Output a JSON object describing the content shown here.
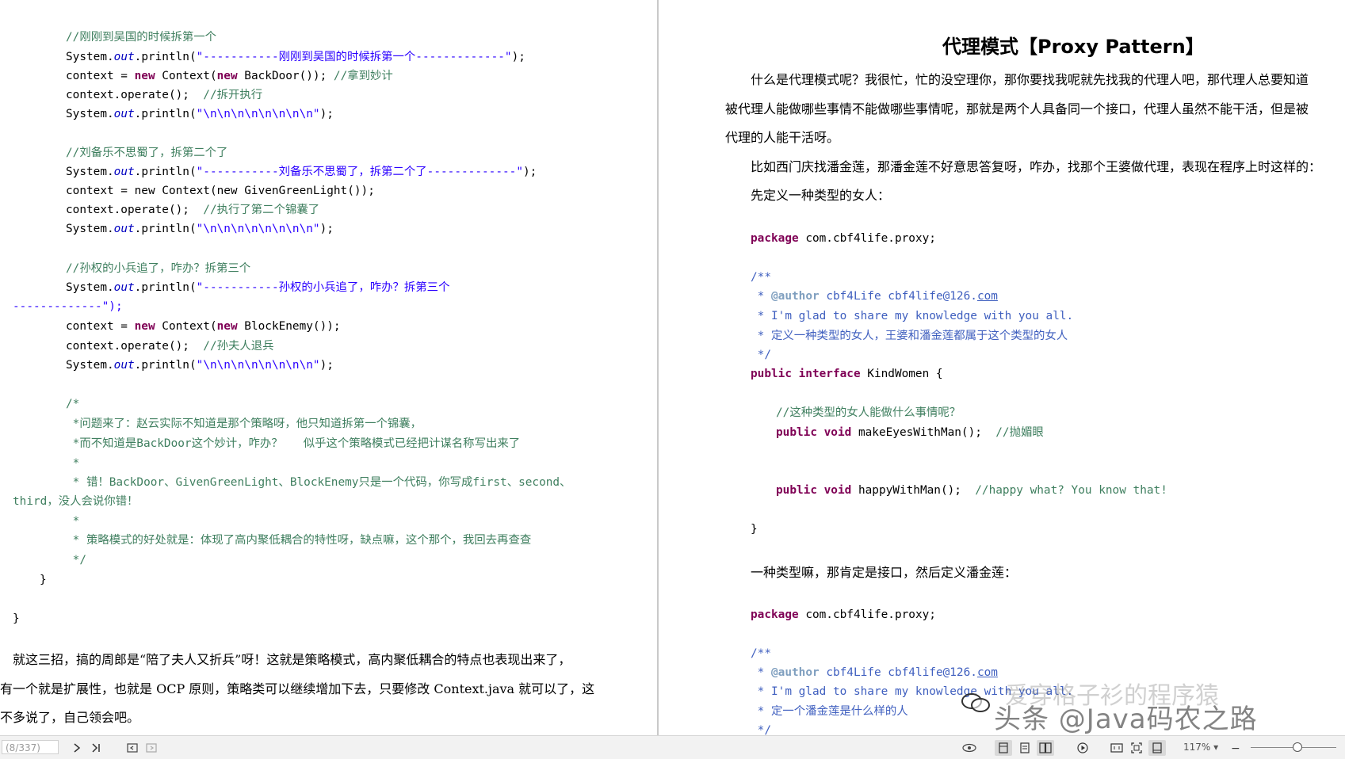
{
  "left": {
    "code_block": [
      "//刚刚到吴国的时候拆第一个",
      "System.out.println(\"-----------刚刚到吴国的时候拆第一个-------------\");",
      "context = new Context(new BackDoor()); //拿到妙计",
      "context.operate();  //拆开执行",
      "System.out.println(\"\\n\\n\\n\\n\\n\\n\\n\\n\");",
      "//刘备乐不思蜀了，拆第二个了",
      "System.out.println(\"-----------刘备乐不思蜀了，拆第二个了-------------\");",
      "context = new Context(new GivenGreenLight());",
      "context.operate();  //执行了第二个锦囊了",
      "System.out.println(\"\\n\\n\\n\\n\\n\\n\\n\\n\");",
      "//孙权的小兵追了，咋办？拆第三个",
      "System.out.println(\"-----------孙权的小兵追了，咋办？拆第三个",
      "-------------\");",
      "context = new Context(new BlockEnemy());",
      "context.operate();  //孙夫人退兵",
      "System.out.println(\"\\n\\n\\n\\n\\n\\n\\n\\n\");",
      "/*",
      " *问题来了：赵云实际不知道是那个策略呀，他只知道拆第一个锦囊，",
      " *而不知道是BackDoor这个妙计，咋办？   似乎这个策略模式已经把计谋名称写出来了",
      " *",
      " * 错！BackDoor、GivenGreenLight、BlockEnemy只是一个代码，你写成first、second、",
      "third，没人会说你错！",
      " *",
      " * 策略模式的好处就是：体现了高内聚低耦合的特性呀，缺点嘛，这个那个，我回去再查查",
      " */",
      "}",
      "}"
    ],
    "paragraph_lines": [
      "就这三招，搞的周郎是“陪了夫人又折兵”呀！这就是策略模式，高内聚低耦合的特点也表现出来了，",
      "有一个就是扩展性，也就是 OCP 原则，策略类可以继续增加下去，只要修改 Context.java 就可以了，这",
      "不多说了，自己领会吧。"
    ]
  },
  "right": {
    "title": "代理模式【Proxy Pattern】",
    "intro_lines": [
      "什么是代理模式呢？我很忙，忙的没空理你，那你要找我呢就先找我的代理人吧，那代理人总要知道",
      "被代理人能做哪些事情不能做哪些事情呢，那就是两个人具备同一个接口，代理人虽然不能干活，但是被",
      "代理的人能干活呀。",
      "比如西门庆找潘金莲，那潘金莲不好意思答复呀，咋办，找那个王婆做代理，表现在程序上时这样的：",
      "先定义一种类型的女人："
    ],
    "code1": [
      "package com.cbf4life.proxy;",
      "/**",
      " * @author cbf4Life cbf4life@126.com",
      " * I'm glad to share my knowledge with you all.",
      " * 定义一种类型的女人，王婆和潘金莲都属于这个类型的女人",
      " */",
      "public interface KindWomen {",
      "//这种类型的女人能做什么事情呢？",
      "public void makeEyesWithMan();  //抛媚眼",
      "public void happyWithMan();  //happy what? You know that!",
      "}"
    ],
    "mid_text": "一种类型嘛，那肯定是接口，然后定义潘金莲：",
    "code2": [
      "package com.cbf4life.proxy;",
      "/**",
      " * @author cbf4Life cbf4life@126.com",
      " * I'm glad to share my knowledge with you all.",
      " * 定一个潘金莲是什么样的人",
      " */"
    ]
  },
  "watermark": "头条 @Java码农之路",
  "watermark_ghost": "爱穿格子衫的程序猿",
  "statusbar": {
    "page_indicator": "(8/337)",
    "zoom": "117%",
    "zoom_fraction": 0.55
  },
  "colors": {
    "keyword": "#7f0055",
    "string": "#2a00ff",
    "comment": "#3f7f5f",
    "javadoc": "#3f5fbf",
    "field": "#0000c0"
  }
}
